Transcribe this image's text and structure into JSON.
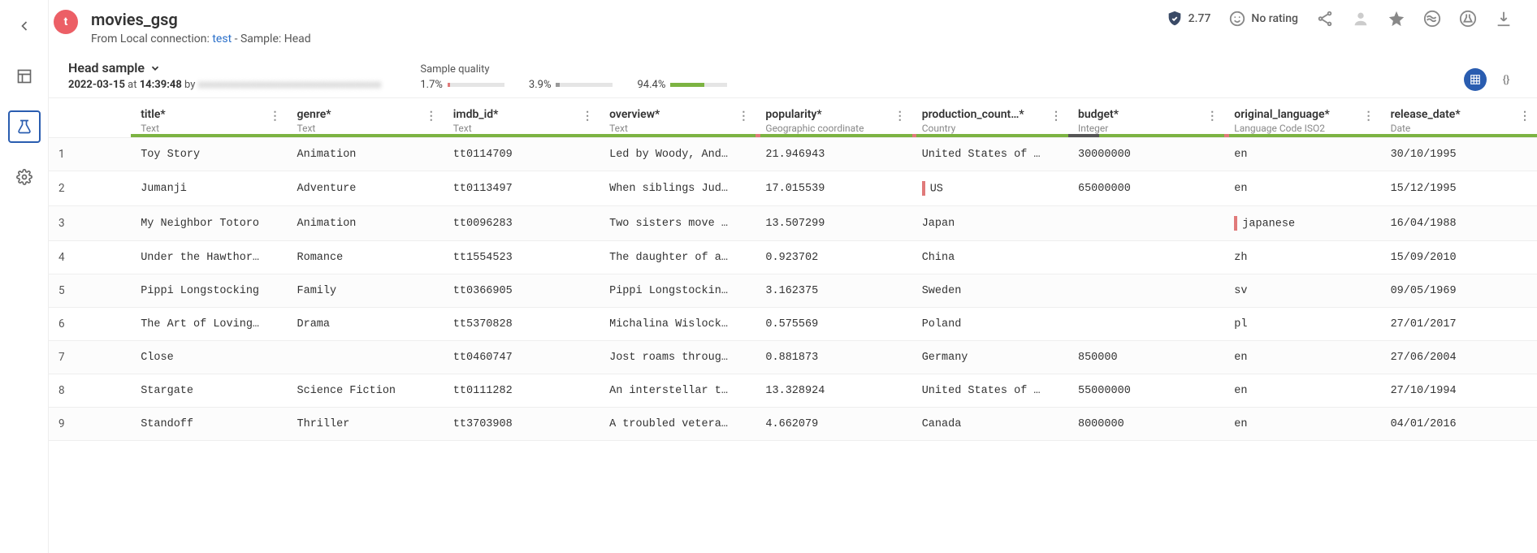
{
  "header": {
    "title": "movies_gsg",
    "from_prefix": "From Local connection: ",
    "from_link": "test",
    "from_suffix": "  -  Sample: Head",
    "shield_value": "2.77",
    "no_rating": "No rating"
  },
  "sample": {
    "title": "Head sample",
    "date": "2022-03-15",
    "at": " at ",
    "time": "14:39:48",
    "by": " by ",
    "author_masked": "xxxxxxxxxxxxxxxxxxxxxxxxxxxxxxxxxxx",
    "quality_label": "Sample quality",
    "q1": {
      "pct": "1.7%",
      "width": "4%",
      "color": "#e07a7a"
    },
    "q2": {
      "pct": "3.9%",
      "width": "6%",
      "color": "#999"
    },
    "q3": {
      "pct": "94.4%",
      "width": "60%",
      "color": "#7cb342"
    }
  },
  "columns": [
    {
      "name": "title*",
      "type": "Text",
      "strip": [
        [
          "#7cb342",
          100
        ]
      ]
    },
    {
      "name": "genre*",
      "type": "Text",
      "strip": [
        [
          "#7cb342",
          100
        ]
      ]
    },
    {
      "name": "imdb_id*",
      "type": "Text",
      "strip": [
        [
          "#7cb342",
          100
        ]
      ]
    },
    {
      "name": "overview*",
      "type": "Text",
      "strip": [
        [
          "#7cb342",
          100
        ]
      ]
    },
    {
      "name": "popularity*",
      "type": "Geographic coordinate",
      "strip": [
        [
          "#e07a7a",
          3
        ],
        [
          "#7cb342",
          97
        ]
      ]
    },
    {
      "name": "production_count…*",
      "type": "Country",
      "strip": [
        [
          "#e07a7a",
          3
        ],
        [
          "#7cb342",
          97
        ]
      ]
    },
    {
      "name": "budget*",
      "type": "Integer",
      "strip": [
        [
          "#555",
          20
        ],
        [
          "#7cb342",
          80
        ]
      ]
    },
    {
      "name": "original_language*",
      "type": "Language Code ISO2",
      "strip": [
        [
          "#e07a7a",
          3
        ],
        [
          "#7cb342",
          97
        ]
      ]
    },
    {
      "name": "release_date*",
      "type": "Date",
      "strip": [
        [
          "#7cb342",
          100
        ]
      ]
    }
  ],
  "rows": [
    {
      "idx": "1",
      "title": "Toy Story",
      "genre": "Animation",
      "imdb_id": "tt0114709",
      "overview": "Led by Woody, And…",
      "popularity": "21.946943",
      "country": "United States of …",
      "budget": "30000000",
      "lang": "en",
      "release": "30/10/1995"
    },
    {
      "idx": "2",
      "title": "Jumanji",
      "genre": "Adventure",
      "imdb_id": "tt0113497",
      "overview": "When siblings Jud…",
      "popularity": "17.015539",
      "country": "US",
      "country_flag": true,
      "budget": "65000000",
      "lang": "en",
      "release": "15/12/1995"
    },
    {
      "idx": "3",
      "title": "My Neighbor Totoro",
      "genre": "Animation",
      "imdb_id": "tt0096283",
      "overview": "Two sisters move …",
      "popularity": "13.507299",
      "country": "Japan",
      "budget": "",
      "lang": "japanese",
      "lang_flag": true,
      "release": "16/04/1988"
    },
    {
      "idx": "4",
      "title": "Under the Hawthor…",
      "genre": "Romance",
      "imdb_id": "tt1554523",
      "overview": "The daughter of a…",
      "popularity": "0.923702",
      "country": "China",
      "budget": "",
      "lang": "zh",
      "release": "15/09/2010"
    },
    {
      "idx": "5",
      "title": "Pippi Longstocking",
      "genre": "Family",
      "imdb_id": "tt0366905",
      "overview": "Pippi Longstockin…",
      "popularity": "3.162375",
      "country": "Sweden",
      "budget": "",
      "lang": "sv",
      "release": "09/05/1969"
    },
    {
      "idx": "6",
      "title": "The Art of Loving…",
      "genre": "Drama",
      "imdb_id": "tt5370828",
      "overview": "Michalina Wislock…",
      "popularity": "0.575569",
      "country": "Poland",
      "budget": "",
      "lang": "pl",
      "release": "27/01/2017"
    },
    {
      "idx": "7",
      "title": "Close",
      "genre": "",
      "imdb_id": "tt0460747",
      "overview": "Jost roams throug…",
      "popularity": "0.881873",
      "country": "Germany",
      "budget": "850000",
      "lang": "en",
      "release": "27/06/2004"
    },
    {
      "idx": "8",
      "title": "Stargate",
      "genre": "Science Fiction",
      "imdb_id": "tt0111282",
      "overview": "An interstellar t…",
      "popularity": "13.328924",
      "country": "United States of …",
      "budget": "55000000",
      "lang": "en",
      "release": "27/10/1994"
    },
    {
      "idx": "9",
      "title": "Standoff",
      "genre": "Thriller",
      "imdb_id": "tt3703908",
      "overview": "A troubled vetera…",
      "popularity": "4.662079",
      "country": "Canada",
      "budget": "8000000",
      "lang": "en",
      "release": "04/01/2016"
    }
  ]
}
